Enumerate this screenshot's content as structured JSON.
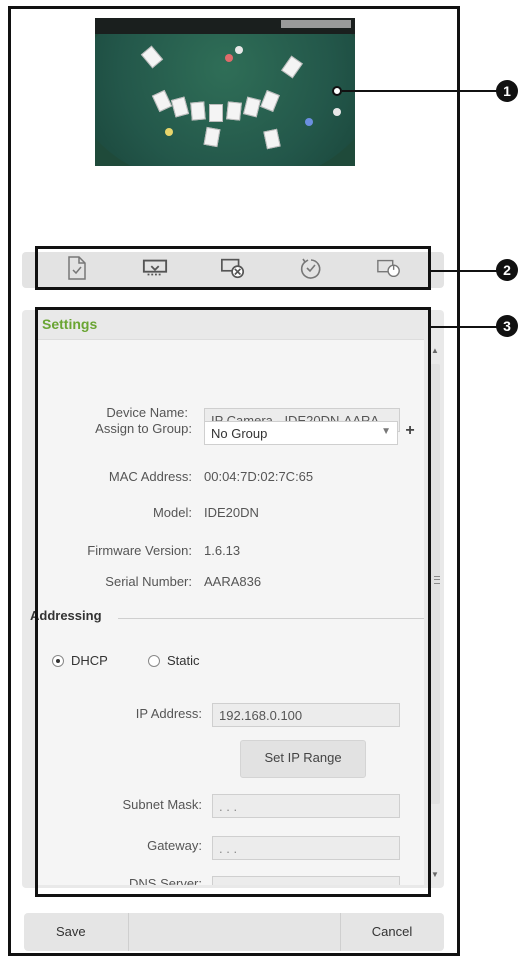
{
  "callouts": [
    "1",
    "2",
    "3"
  ],
  "toolbar": {
    "icons": [
      "document-check-icon",
      "camera-discover-icon",
      "camera-remove-icon",
      "reset-icon",
      "reboot-icon"
    ]
  },
  "settings": {
    "title": "Settings",
    "device_name_label": "Device Name:",
    "device_name_value": "IP Camera - IDE20DN-AARA",
    "assign_group_label": "Assign to Group:",
    "assign_group_value": "No Group",
    "mac_label": "MAC Address:",
    "mac_value": "00:04:7D:02:7C:65",
    "model_label": "Model:",
    "model_value": "IDE20DN",
    "firmware_label": "Firmware Version:",
    "firmware_value": "1.6.13",
    "serial_label": "Serial Number:",
    "serial_value": "AARA836"
  },
  "addressing": {
    "title": "Addressing",
    "dhcp_label": "DHCP",
    "static_label": "Static",
    "selected": "DHCP",
    "ip_label": "IP Address:",
    "ip_value": "192.168.0.100",
    "set_ip_range_label": "Set IP Range",
    "subnet_label": "Subnet Mask:",
    "subnet_value": ". . .",
    "gateway_label": "Gateway:",
    "gateway_value": ". . .",
    "dns_label": "DNS Server:"
  },
  "footer": {
    "save_label": "Save",
    "cancel_label": "Cancel"
  }
}
